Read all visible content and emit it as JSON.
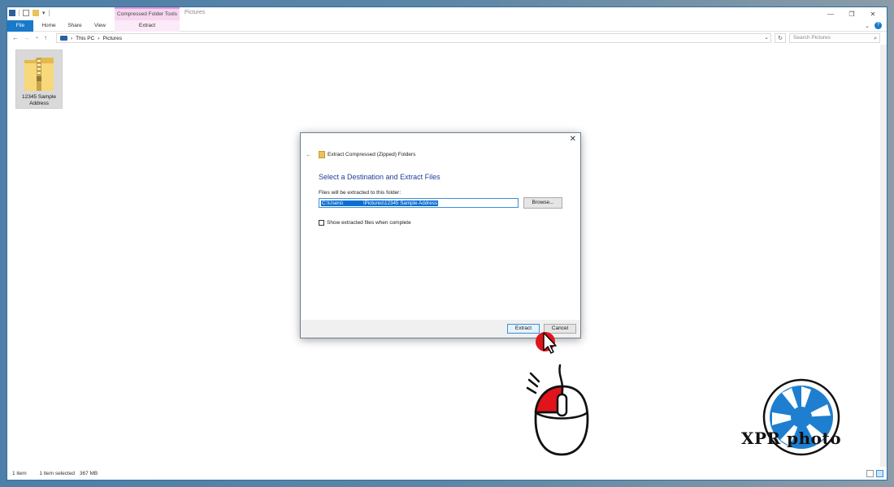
{
  "window": {
    "context_tab_group": "Compressed Folder Tools",
    "title": "Pictures"
  },
  "ribbon": {
    "tabs": [
      "File",
      "Home",
      "Share",
      "View",
      "Extract"
    ]
  },
  "address": {
    "crumbs": [
      "This PC",
      "Pictures"
    ],
    "search_placeholder": "Search Pictures"
  },
  "files": [
    {
      "name": "12345 Sample Address"
    }
  ],
  "status": {
    "items": "1 item",
    "selection": "1 item selected",
    "size": "367 MB"
  },
  "dialog": {
    "title": "Extract Compressed (Zipped) Folders",
    "heading": "Select a Destination and Extract Files",
    "label": "Files will be extracted to this folder:",
    "path": "C:\\Users\\              \\Pictures\\12345 Sample Address",
    "browse": "Browse...",
    "checkbox_label": "Show extracted files when complete",
    "checkbox_checked": false,
    "extract": "Extract",
    "cancel": "Cancel"
  },
  "overlay": {
    "brand": "XPR photo"
  },
  "colors": {
    "accent": "#1979ca",
    "context_tab": "#f6d7ef",
    "dialog_heading": "#1f3d99",
    "highlight_red": "#e0141a"
  }
}
